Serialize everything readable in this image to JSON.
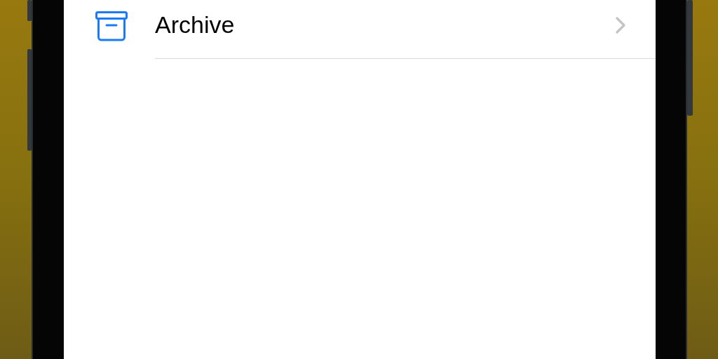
{
  "screen": {
    "rows": [
      {
        "label": "Archive"
      }
    ]
  }
}
